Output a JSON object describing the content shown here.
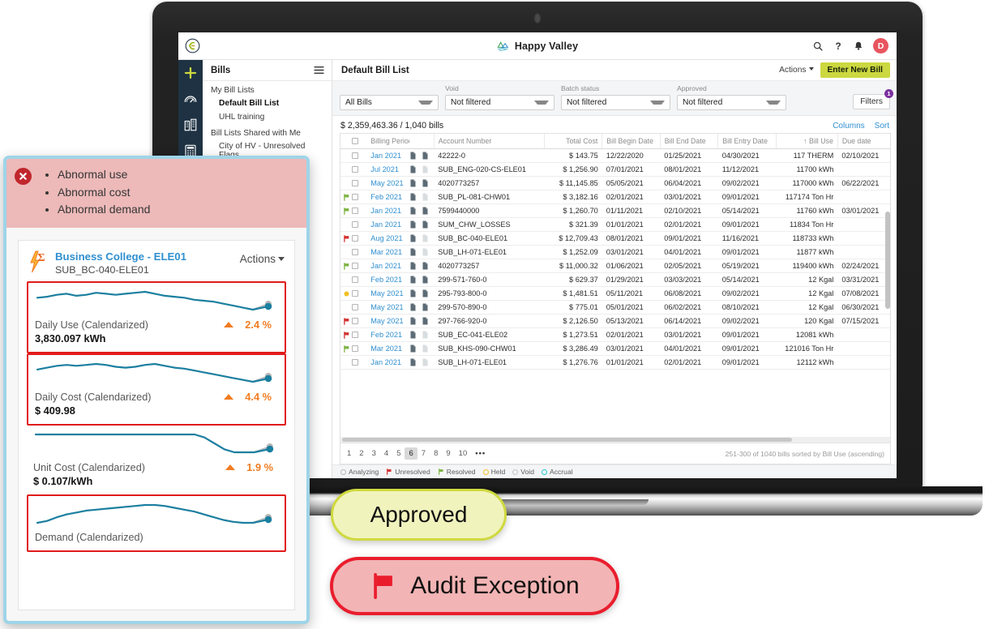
{
  "topbar": {
    "logo_icon": "stylized-e-logo",
    "app_title": "Happy Valley",
    "app_logo_icon": "mountain-water-icon",
    "search_icon": "search-icon",
    "help_icon": "question-mark-icon",
    "bell_icon": "bell-icon",
    "avatar_initial": "D"
  },
  "rail": {
    "items": [
      {
        "icon": "plus-icon",
        "name": "add"
      },
      {
        "icon": "gauge-icon",
        "name": "dashboard"
      },
      {
        "icon": "building-icon",
        "name": "buildings"
      },
      {
        "icon": "calculator-icon",
        "name": "calculator"
      }
    ]
  },
  "listpane": {
    "title": "Bills",
    "menu_icon": "hamburger-icon",
    "groups": [
      {
        "label": "My Bill Lists",
        "items": [
          {
            "label": "Default Bill List",
            "selected": true
          },
          {
            "label": "UHL training",
            "selected": false
          }
        ]
      },
      {
        "label": "Bill Lists Shared with Me",
        "items": [
          {
            "label": "City of HV - Unresolved Flags",
            "selected": false
          }
        ]
      }
    ]
  },
  "main": {
    "title": "Default Bill List",
    "actions_label": "Actions",
    "enter_new_bill_label": "Enter New Bill"
  },
  "filters": {
    "scope": {
      "label": "",
      "value": "All Bills"
    },
    "void": {
      "label": "Void",
      "value": "Not filtered"
    },
    "batch_status": {
      "label": "Batch status",
      "value": "Not filtered"
    },
    "approved": {
      "label": "Approved",
      "value": "Not filtered"
    },
    "filters_button": "Filters",
    "filters_badge": "1"
  },
  "table": {
    "summary": "$ 2,359,463.36 / 1,040 bills",
    "columns_link": "Columns",
    "sort_link": "Sort",
    "headers": {
      "billing_period": "Billing Period",
      "account_number": "Account Number",
      "total_cost": "Total Cost",
      "bill_begin_date": "Bill Begin Date",
      "bill_end_date": "Bill End Date",
      "bill_entry_date": "Bill Entry Date",
      "bill_use": "Bill Use",
      "due_date": "Due date"
    },
    "sort_indicator": "↑",
    "rows": [
      {
        "flag": "none",
        "period": "Jan 2021",
        "account": "42222-0",
        "cost": "$ 143.75",
        "begin": "12/22/2020",
        "end": "01/25/2021",
        "entry": "04/30/2021",
        "use": "117 THERM",
        "due": "02/10/2021"
      },
      {
        "flag": "none",
        "period": "Jul 2021",
        "account": "SUB_ENG-020-CS-ELE01",
        "cost": "$ 1,256.90",
        "begin": "07/01/2021",
        "end": "08/01/2021",
        "entry": "11/12/2021",
        "use": "11700 kWh",
        "due": ""
      },
      {
        "flag": "none",
        "period": "May 2021",
        "account": "4020773257",
        "cost": "$ 11,145.85",
        "begin": "05/05/2021",
        "end": "06/04/2021",
        "entry": "09/02/2021",
        "use": "117000 kWh",
        "due": "06/22/2021"
      },
      {
        "flag": "resolved",
        "period": "Feb 2021",
        "account": "SUB_PL-081-CHW01",
        "cost": "$ 3,182.16",
        "begin": "02/01/2021",
        "end": "03/01/2021",
        "entry": "09/01/2021",
        "use": "117174 Ton Hr",
        "due": ""
      },
      {
        "flag": "resolved",
        "period": "Jan 2021",
        "account": "7599440000",
        "cost": "$ 1,260.70",
        "begin": "01/11/2021",
        "end": "02/10/2021",
        "entry": "05/14/2021",
        "use": "11760 kWh",
        "due": "03/01/2021"
      },
      {
        "flag": "none",
        "period": "Jan 2021",
        "account": "SUM_CHW_LOSSES",
        "cost": "$ 321.39",
        "begin": "01/01/2021",
        "end": "02/01/2021",
        "entry": "09/01/2021",
        "use": "11834 Ton Hr",
        "due": ""
      },
      {
        "flag": "unresolved",
        "period": "Aug 2021",
        "account": "SUB_BC-040-ELE01",
        "cost": "$ 12,709.43",
        "begin": "08/01/2021",
        "end": "09/01/2021",
        "entry": "11/16/2021",
        "use": "118733 kWh",
        "due": ""
      },
      {
        "flag": "none",
        "period": "Mar 2021",
        "account": "SUB_LH-071-ELE01",
        "cost": "$ 1,252.09",
        "begin": "03/01/2021",
        "end": "04/01/2021",
        "entry": "09/01/2021",
        "use": "11877 kWh",
        "due": ""
      },
      {
        "flag": "resolved",
        "period": "Jan 2021",
        "account": "4020773257",
        "cost": "$ 11,000.32",
        "begin": "01/06/2021",
        "end": "02/05/2021",
        "entry": "05/19/2021",
        "use": "119400 kWh",
        "due": "02/24/2021"
      },
      {
        "flag": "none",
        "period": "Feb 2021",
        "account": "299-571-760-0",
        "cost": "$ 629.37",
        "begin": "01/29/2021",
        "end": "03/03/2021",
        "entry": "05/14/2021",
        "use": "12 Kgal",
        "due": "03/31/2021"
      },
      {
        "flag": "held",
        "period": "May 2021",
        "account": "295-793-800-0",
        "cost": "$ 1,481.51",
        "begin": "05/11/2021",
        "end": "06/08/2021",
        "entry": "09/02/2021",
        "use": "12 Kgal",
        "due": "07/08/2021"
      },
      {
        "flag": "none",
        "period": "May 2021",
        "account": "299-570-890-0",
        "cost": "$ 775.01",
        "begin": "05/01/2021",
        "end": "06/02/2021",
        "entry": "08/10/2021",
        "use": "12 Kgal",
        "due": "06/30/2021"
      },
      {
        "flag": "unresolved",
        "period": "May 2021",
        "account": "297-766-920-0",
        "cost": "$ 2,126.50",
        "begin": "05/13/2021",
        "end": "06/14/2021",
        "entry": "09/02/2021",
        "use": "120 Kgal",
        "due": "07/15/2021"
      },
      {
        "flag": "unresolved",
        "period": "Feb 2021",
        "account": "SUB_EC-041-ELE02",
        "cost": "$ 1,273.51",
        "begin": "02/01/2021",
        "end": "03/01/2021",
        "entry": "09/01/2021",
        "use": "12081 kWh",
        "due": ""
      },
      {
        "flag": "resolved",
        "period": "Mar 2021",
        "account": "SUB_KHS-090-CHW01",
        "cost": "$ 3,286.49",
        "begin": "03/01/2021",
        "end": "04/01/2021",
        "entry": "09/01/2021",
        "use": "121016 Ton Hr",
        "due": ""
      },
      {
        "flag": "none",
        "period": "Jan 2021",
        "account": "SUB_LH-071-ELE01",
        "cost": "$ 1,276.76",
        "begin": "01/01/2021",
        "end": "02/01/2021",
        "entry": "09/01/2021",
        "use": "12112 kWh",
        "due": ""
      }
    ]
  },
  "pagination": {
    "pages": [
      "1",
      "2",
      "3",
      "4",
      "5",
      "6",
      "7",
      "8",
      "9",
      "10"
    ],
    "current": "6",
    "more": "•••",
    "note": "251-300 of 1040 bills sorted by Bill Use (ascending)"
  },
  "legend": [
    {
      "label": "Analyzing",
      "color": "#b8b8b8",
      "shape": "circle"
    },
    {
      "label": "Unresolved",
      "color": "#d32f2f",
      "shape": "flag"
    },
    {
      "label": "Resolved",
      "color": "#7cb342",
      "shape": "flag"
    },
    {
      "label": "Held",
      "color": "#f2c023",
      "shape": "circle"
    },
    {
      "label": "Void",
      "color": "#c4c4c4",
      "shape": "circle"
    },
    {
      "label": "Accrual",
      "color": "#26c6da",
      "shape": "circle"
    }
  ],
  "detail_panel": {
    "alert_icon": "error-x-icon",
    "alerts": [
      "Abnormal use",
      "Abnormal cost",
      "Abnormal demand"
    ],
    "meter_icon": "bolt-sigma-icon",
    "meter_name": "Business College - ELE01",
    "meter_code": "SUB_BC-040-ELE01",
    "actions_label": "Actions",
    "metrics": [
      {
        "name": "Daily Use (Calendarized)",
        "value": "3,830.097 kWh",
        "trend_icon": "triangle-up-icon",
        "pct": "2.4 %",
        "highlighted": true,
        "sparkline": [
          20,
          21,
          23,
          24,
          22,
          23,
          25,
          24,
          23,
          24,
          25,
          26,
          24,
          22,
          21,
          20,
          18,
          17,
          16,
          14,
          12,
          10,
          8
        ],
        "ghost": true
      },
      {
        "name": "Daily Cost (Calendarized)",
        "value": "$ 409.98",
        "trend_icon": "triangle-up-icon",
        "pct": "4.4 %",
        "highlighted": true,
        "sparkline": [
          20,
          22,
          24,
          25,
          24,
          25,
          26,
          25,
          23,
          22,
          23,
          25,
          26,
          24,
          22,
          21,
          19,
          17,
          15,
          13,
          11,
          9,
          7
        ],
        "ghost": true
      },
      {
        "name": "Unit Cost (Calendarized)",
        "value": "$ 0.107/kWh",
        "trend_icon": "triangle-up-icon",
        "pct": "1.9 %",
        "highlighted": false,
        "sparkline": [
          24,
          24,
          24,
          24,
          24,
          24,
          24,
          24,
          24,
          24,
          24,
          24,
          24,
          24,
          24,
          24,
          24,
          22,
          18,
          14,
          12,
          12,
          12
        ],
        "ghost": true
      },
      {
        "name": "Demand (Calendarized)",
        "value": "",
        "trend_icon": "",
        "pct": "",
        "highlighted": true,
        "sparkline": [
          10,
          12,
          16,
          19,
          21,
          23,
          24,
          25,
          26,
          27,
          28,
          29,
          29,
          28,
          26,
          24,
          22,
          19,
          16,
          13,
          11,
          10,
          10
        ],
        "ghost": true
      }
    ]
  },
  "callouts": {
    "approved": "Approved",
    "audit_exception": "Audit Exception",
    "audit_flag_icon": "red-flag-icon"
  },
  "colors": {
    "accent_blue": "#2f8fd0",
    "primary_button": "#ccd840",
    "alert_red": "#e11b1b",
    "trend_orange": "#f07c22",
    "rail_navy": "#1e3243",
    "panel_border": "#9fd4e8"
  }
}
